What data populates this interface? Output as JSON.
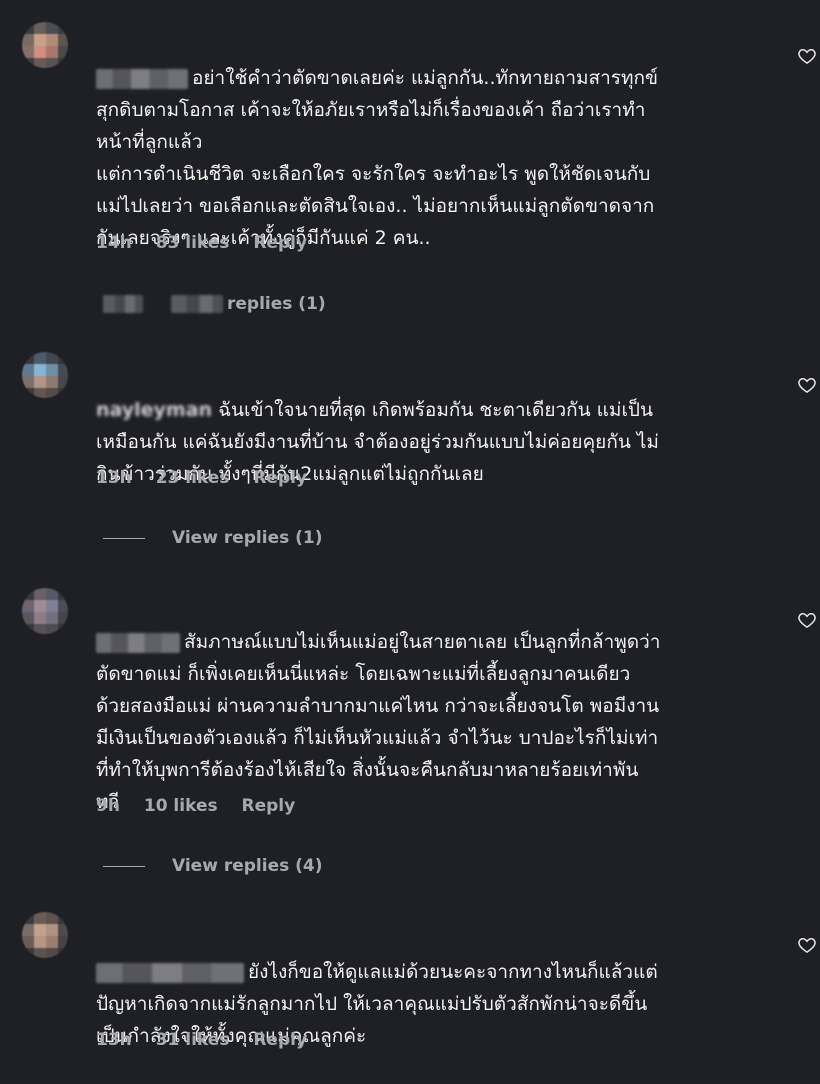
{
  "comments": [
    {
      "text_line1": "อย่าใช้คำว่าตัดขาดเลยค่ะ แม่ลูกกัน..ทักทายถามสารทุกข์",
      "text_rest": "สุกดิบตามโอกาส เค้าจะให้อภัยเราหรือไม่ก็เรื่องของเค้า ถือว่าเราทำ\nหน้าที่ลูกแล้ว\nแต่การดำเนินชีวิต จะเลือกใคร จะรักใคร จะทำอะไร พูดให้ชัดเจนกับ\nแม่ไปเลยว่า ขอเลือกและตัดสินใจเอง.. ไม่อยากเห็นแม่ลูกตัดขาดจาก\nกันเลยจริงๆ และเค้าทั้งคู่ก็มีกันแค่ 2 คน..",
      "time": "14h",
      "likes": "83 likes",
      "reply": "Reply",
      "view_replies": "replies (1)"
    },
    {
      "username_fragment": "nayleyman",
      "text_line1": "ฉันเข้าใจนายที่สุด เกิดพร้อมกัน ชะตาเดียวกัน แม่เป็น",
      "text_rest": "เหมือนกัน แค่ฉันยังมีงานที่บ้าน จำต้องอยู่ร่วมกันแบบไม่ค่อยคุยกัน ไม่\nกินข้าวร่วมกัน ทั้งๆที่มีกัน2แม่ลูกแต่ไม่ถูกกันเลย",
      "time": "13h",
      "likes": "23 likes",
      "reply": "Reply",
      "view_replies": "View replies (1)"
    },
    {
      "text_line1": "สัมภาษณ์แบบไม่เห็นแม่อยู่ในสายตาเลย เป็นลูกที่กล้าพูดว่า",
      "text_rest": "ตัดขาดแม่ ก็เพิ่งเคยเห็นนี่แหล่ะ โดยเฉพาะแม่ที่เลี้ยงลูกมาคนเดียว\nด้วยสองมือแม่ ผ่านความลำบากมาแค่ไหน กว่าจะเลี้ยงจนโต พอมีงาน\nมีเงินเป็นของตัวเองแล้ว ก็ไม่เห็นหัวแม่แล้ว จำไว้นะ บาปอะไรก็ไม่เท่า\nที่ทำให้บุพการีต้องร้องไห้เสียใจ สิ่งนั้นจะคืนกลับมาหลายร้อยเท่าพัน\nทวี",
      "time": "9h",
      "likes": "10 likes",
      "reply": "Reply",
      "view_replies": "View replies (4)"
    },
    {
      "text_line1": "ยังไงก็ขอให้ดูแลแม่ด้วยนะคะจากทางไหนก็แล้วแต่",
      "text_rest": "ปัญหาเกิดจากแม่รักลูกมากไป ให้เวลาคุณแม่ปรับตัวสักพักน่าจะดีขึ้น\nเป็นกำลังใจให้ทั้งคุณแม่คุณลูกค่ะ",
      "time": "13h",
      "likes": "31 likes",
      "reply": "Reply"
    }
  ],
  "icons": {
    "like": "heart-outline-icon"
  },
  "colors": {
    "background": "#1f2025",
    "text": "#f1f1f1",
    "meta": "#a8a9ad"
  }
}
